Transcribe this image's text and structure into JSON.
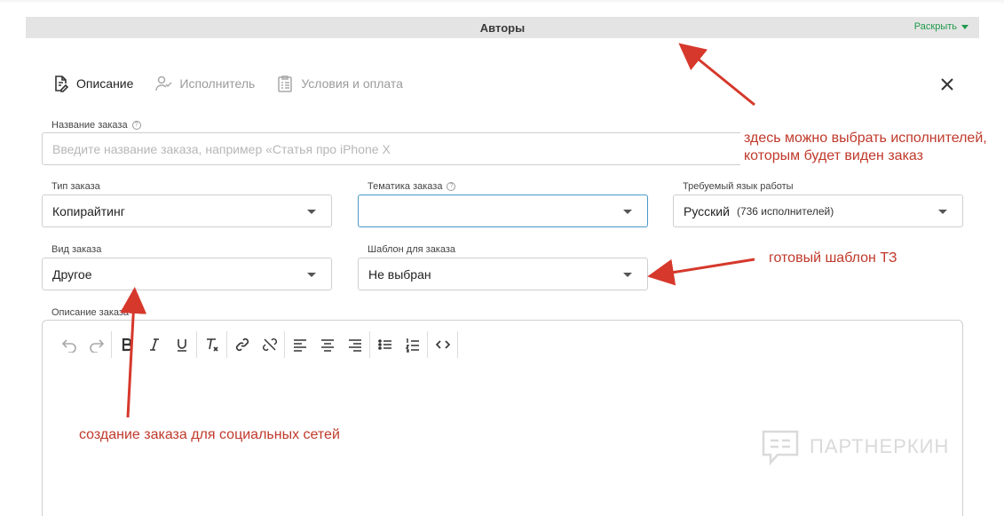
{
  "authors_bar": {
    "title": "Авторы",
    "expand_label": "Раскрыть"
  },
  "tabs": [
    {
      "label": "Описание",
      "icon": "document-edit-icon",
      "active": true
    },
    {
      "label": "Исполнитель",
      "icon": "user-check-icon",
      "active": false
    },
    {
      "label": "Условия и оплата",
      "icon": "clipboard-list-icon",
      "active": false
    }
  ],
  "form": {
    "order_name": {
      "label": "Название заказа",
      "placeholder": "Введите название заказа, например «Статья про iPhone X"
    },
    "order_type": {
      "label": "Тип заказа",
      "value": "Копирайтинг"
    },
    "order_topic": {
      "label": "Тематика заказа",
      "value": ""
    },
    "language": {
      "label": "Требуемый язык работы",
      "value": "Русский",
      "sub": "(736 исполнителей)"
    },
    "order_kind": {
      "label": "Вид заказа",
      "value": "Другое"
    },
    "template": {
      "label": "Шаблон для заказа",
      "value": "Не выбран"
    },
    "description": {
      "label": "Описание заказа"
    }
  },
  "toolbar": [
    "undo-icon",
    "redo-icon",
    "bold-icon",
    "italic-icon",
    "underline-icon",
    "clear-format-icon",
    "link-icon",
    "unlink-icon",
    "align-left-icon",
    "align-center-icon",
    "align-right-icon",
    "bullet-list-icon",
    "numbered-list-icon",
    "code-icon"
  ],
  "annotations": {
    "performers_line1": "здесь можно выбрать исполнителей,",
    "performers_line2": "которым будет виден заказ",
    "template": "готовый шаблон ТЗ",
    "social": "создание заказа для социальных сетей"
  },
  "watermark": {
    "text": "ПАРТНЕРКИН",
    "icon": "chat-logo-icon"
  },
  "colors": {
    "accent_green": "#1f9a4a",
    "annotation_red": "#c0392b",
    "focus_blue": "#4a98c8"
  }
}
